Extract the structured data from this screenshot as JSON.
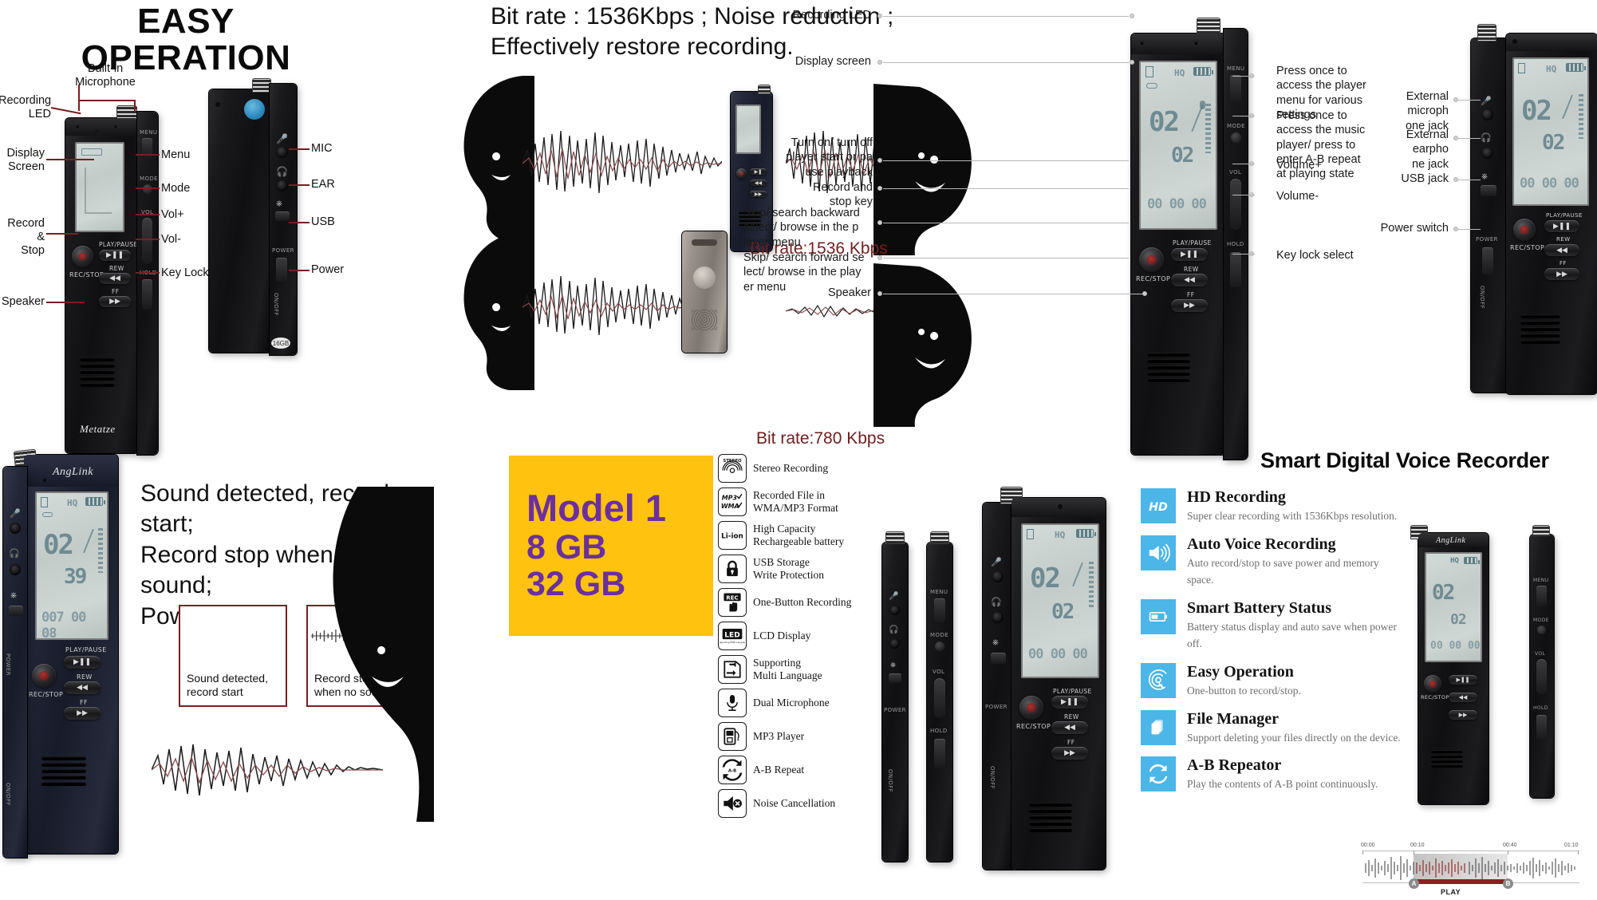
{
  "headings": {
    "easy_operation_line1": "EASY",
    "easy_operation_line2": "OPERATION",
    "bitrate_headline_line1": "Bit rate : 1536Kbps ;  Noise reduction ;",
    "bitrate_headline_line2": "Effectively restore recording.",
    "sound_detect_line1": "Sound detected, record start;",
    "sound_detect_line2": "Record stop when no sound;",
    "sound_detect_line3": "Power saving",
    "smart_title": "Smart Digital Voice Recorder"
  },
  "left_diagram": {
    "callouts": [
      {
        "label": "Built-in\nMicrophone"
      },
      {
        "label": "Recording\nLED"
      },
      {
        "label": "Display\nScreen"
      },
      {
        "label": "Record\n&\nStop"
      },
      {
        "label": "Speaker"
      },
      {
        "label": "Menu"
      },
      {
        "label": "Mode"
      },
      {
        "label": "Vol+"
      },
      {
        "label": "Vol-"
      },
      {
        "label": "Key Lock"
      }
    ],
    "front_device": {
      "brand": "Metatze",
      "buttons": [
        "PLAY/PAUSE",
        "REW",
        "FF"
      ],
      "rec_label": "REC/STOP",
      "side_labels": [
        "MENU",
        "MODE",
        "VOL",
        "HOLD"
      ]
    },
    "side_device": {
      "capacity_badge": "16GB",
      "labels": [
        "POWER",
        "ON/OFF"
      ]
    }
  },
  "middle_right_diagram": {
    "callouts_left": [
      "Recording LED",
      "Display screen",
      "Turn on/ turn off\nplayer start or pa\nuse playback",
      "Record and\nstop key",
      "Skip/ search backward\nselect/ browse in the p\nlayer menu",
      "Skip/ search forward se\nlect/ browse in the play\ner menu",
      "Speaker"
    ],
    "callouts_right": [
      "Press once to\naccess the player\nmenu for various\nsettings",
      "Press once to\naccess the music\nplayer/ press to\nenter A-B repeat\nat playing state",
      "Volume+",
      "Volume-",
      "Key lock select"
    ],
    "far_right_callouts": [
      "External\nmicroph\none jack",
      "External\nearpho\nne jack",
      "USB jack",
      "Power switch"
    ]
  },
  "bitrates": {
    "top": "Bit rate:1536 Kbps",
    "bottom": "Bit rate:780 Kbps"
  },
  "model_badge": {
    "line1": "Model 1",
    "line2": "8 GB",
    "line3": "32 GB",
    "background": "#ffc20e",
    "text_color": "#6b2fa0"
  },
  "waveform_boxes": [
    {
      "caption_line1": "Sound detected,",
      "caption_line2": "record start",
      "color": "#e03a12"
    },
    {
      "caption_line1": "Record stop",
      "caption_line2": "when no sound",
      "color": "#3c3c3c"
    }
  ],
  "feature_icons": [
    {
      "icon": "stereo-icon",
      "glyph": "STEREO",
      "line1": "Stereo Recording",
      "line2": ""
    },
    {
      "icon": "mp3-wma-icon",
      "glyph": "MP3WMA",
      "line1": "Recorded File in",
      "line2": "WMA/MP3 Format"
    },
    {
      "icon": "li-ion-battery-icon",
      "glyph": "Li-ion",
      "line1": "High Capacity",
      "line2": "Rechargeable battery"
    },
    {
      "icon": "lock-icon",
      "glyph": "LOCK",
      "line1": "USB Storage",
      "line2": "Write Protection"
    },
    {
      "icon": "one-button-record-icon",
      "glyph": "REC",
      "line1": "One-Button Recording",
      "line2": ""
    },
    {
      "icon": "lcd-display-icon",
      "glyph": "LED",
      "line1": "LCD Display",
      "line2": ""
    },
    {
      "icon": "multi-language-icon",
      "glyph": "LANG",
      "line1": "Supporting",
      "line2": "Multi Language"
    },
    {
      "icon": "dual-microphone-icon",
      "glyph": "MIC",
      "line1": "Dual Microphone",
      "line2": ""
    },
    {
      "icon": "mp3-player-icon",
      "glyph": "PLAYER",
      "line1": "MP3 Player",
      "line2": ""
    },
    {
      "icon": "ab-repeat-icon",
      "glyph": "AB",
      "line1": "A-B Repeat",
      "line2": ""
    },
    {
      "icon": "noise-cancellation-icon",
      "glyph": "MUTE",
      "line1": "Noise Cancellation",
      "line2": ""
    }
  ],
  "blue_features": [
    {
      "icon": "hd-icon",
      "title": "HD Recording",
      "desc": "Super clear recording with 1536Kbps resolution."
    },
    {
      "icon": "speaker-icon",
      "title": "Auto Voice Recording",
      "desc": "Auto record/stop to save power and memory space."
    },
    {
      "icon": "battery-icon",
      "title": "Smart Battery Status",
      "desc": "Battery status display and auto save when power off."
    },
    {
      "icon": "fingerprint-icon",
      "title": "Easy Operation",
      "desc": "One-button to record/stop."
    },
    {
      "icon": "files-icon",
      "title": "File Manager",
      "desc": "Support deleting your files directly on the device."
    },
    {
      "icon": "repeat-icon",
      "title": "A-B Repeator",
      "desc": "Play the contents of A-B point continuously."
    }
  ],
  "ab_player": {
    "times": [
      "00:00",
      "00:10",
      "00:40",
      "01:10"
    ],
    "marker_a": "A",
    "marker_b": "B",
    "play_label": "PLAY"
  },
  "lcd": {
    "quality": "HQ",
    "big_number": "02",
    "mid_number": "02",
    "bottom_time": "00 00 00",
    "alt_mid_number": "39",
    "alt_bottom_time": "007 00 08"
  },
  "colors": {
    "accent_yellow": "#ffc20e",
    "accent_purple": "#6b2fa0",
    "accent_blue": "#4cb6e8",
    "leader_red": "#7b1d22",
    "bitrate_text": "#6f2020"
  }
}
